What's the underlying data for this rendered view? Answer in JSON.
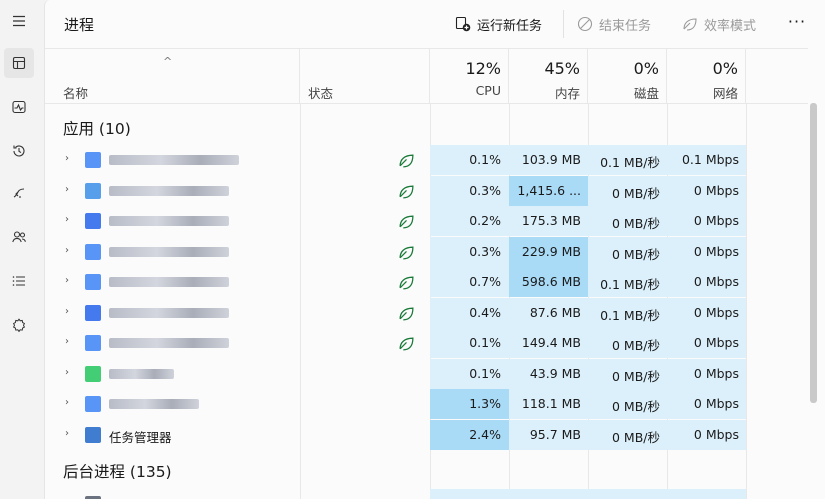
{
  "app": {
    "title": "进程"
  },
  "toolbar": {
    "run_task": "运行新任务",
    "end_task": "结束任务",
    "efficiency_mode": "效率模式",
    "more": "···"
  },
  "header": {
    "name": "名称",
    "status": "状态",
    "cpu": {
      "pct": "12%",
      "label": "CPU"
    },
    "memory": {
      "pct": "45%",
      "label": "内存"
    },
    "disk": {
      "pct": "0%",
      "label": "磁盘"
    },
    "network": {
      "pct": "0%",
      "label": "网络"
    }
  },
  "groups": {
    "apps": "应用 (10)",
    "background": "后台进程 (135)"
  },
  "rows": [
    {
      "name": "",
      "efficiency": true,
      "cpu": "0.1%",
      "mem": "103.9 MB",
      "disk": "0.1 MB/秒",
      "net": "0.1 Mbps",
      "memHigh": false
    },
    {
      "name": "",
      "efficiency": true,
      "cpu": "0.3%",
      "mem": "1,415.6 ...",
      "disk": "0 MB/秒",
      "net": "0 Mbps",
      "memHigh": true
    },
    {
      "name": "",
      "efficiency": true,
      "cpu": "0.2%",
      "mem": "175.3 MB",
      "disk": "0 MB/秒",
      "net": "0 Mbps",
      "memHigh": false
    },
    {
      "name": "",
      "efficiency": true,
      "cpu": "0.3%",
      "mem": "229.9 MB",
      "disk": "0 MB/秒",
      "net": "0 Mbps",
      "memHigh": true
    },
    {
      "name": "",
      "efficiency": true,
      "cpu": "0.7%",
      "mem": "598.6 MB",
      "disk": "0.1 MB/秒",
      "net": "0 Mbps",
      "memHigh": true
    },
    {
      "name": "",
      "efficiency": true,
      "cpu": "0.4%",
      "mem": "87.6 MB",
      "disk": "0.1 MB/秒",
      "net": "0 Mbps",
      "memHigh": false
    },
    {
      "name": "",
      "efficiency": true,
      "cpu": "0.1%",
      "mem": "149.4 MB",
      "disk": "0 MB/秒",
      "net": "0 Mbps",
      "memHigh": false
    },
    {
      "name": "",
      "efficiency": false,
      "cpu": "0.1%",
      "mem": "43.9 MB",
      "disk": "0 MB/秒",
      "net": "0 Mbps",
      "memHigh": false
    },
    {
      "name": "",
      "efficiency": false,
      "cpu": "1.3%",
      "mem": "118.1 MB",
      "disk": "0 MB/秒",
      "net": "0 Mbps",
      "memHigh": false,
      "cpuHigh": true
    },
    {
      "name": "任务管理器",
      "efficiency": false,
      "cpu": "2.4%",
      "mem": "95.7 MB",
      "disk": "0 MB/秒",
      "net": "0 Mbps",
      "memHigh": false,
      "cpuHigh": true
    }
  ],
  "colors": {
    "cell": "#dcf0fb",
    "cellHigh": "#a9dbf7",
    "accent": "#1a7a3a"
  },
  "icons": {
    "rail": [
      "hamburger-icon",
      "processes-icon",
      "performance-icon",
      "app-history-icon",
      "startup-icon",
      "users-icon",
      "details-icon",
      "services-icon"
    ],
    "toolbar": [
      "run-task-icon",
      "end-task-icon",
      "efficiency-icon",
      "more-icon"
    ]
  }
}
